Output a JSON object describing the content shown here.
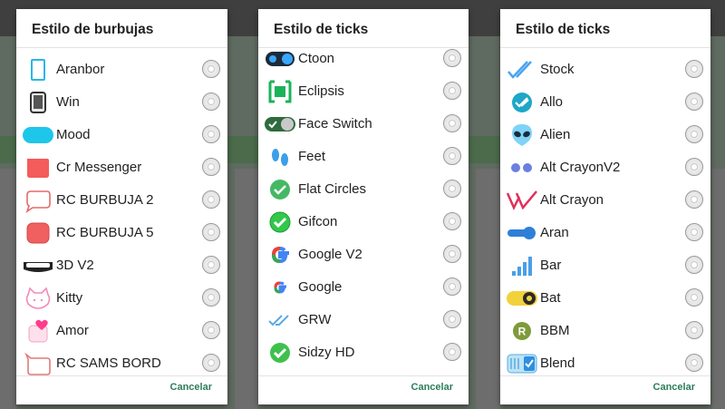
{
  "dialogs": [
    {
      "title": "Estilo de burbujas",
      "cancel": "Cancelar",
      "items": [
        {
          "label": "Aranbor",
          "icon": "bubble-outline-icon"
        },
        {
          "label": "Win",
          "icon": "bubble-window-icon"
        },
        {
          "label": "Mood",
          "icon": "bubble-pill-icon"
        },
        {
          "label": "Cr Messenger",
          "icon": "bubble-messenger-icon"
        },
        {
          "label": "RC BURBUJA 2",
          "icon": "bubble-speech-icon"
        },
        {
          "label": "RC BURBUJA 5",
          "icon": "bubble-rounded-icon"
        },
        {
          "label": "3D V2",
          "icon": "bubble-3d-icon"
        },
        {
          "label": "Kitty",
          "icon": "bubble-kitty-icon"
        },
        {
          "label": "Amor",
          "icon": "bubble-heart-icon"
        },
        {
          "label": "RC SAMS BORD",
          "icon": "bubble-border-icon"
        }
      ]
    },
    {
      "title": "Estilo de ticks",
      "cancel": "Cancelar",
      "items": [
        {
          "label": "Ctoon",
          "icon": "tick-ctoon-icon"
        },
        {
          "label": "Eclipsis",
          "icon": "tick-eclipsis-icon"
        },
        {
          "label": "Face Switch",
          "icon": "tick-switch-icon"
        },
        {
          "label": "Feet",
          "icon": "tick-feet-icon"
        },
        {
          "label": "Flat Circles",
          "icon": "tick-flat-circle-icon"
        },
        {
          "label": "Gifcon",
          "icon": "tick-gifcon-icon"
        },
        {
          "label": "Google V2",
          "icon": "google-v2-icon"
        },
        {
          "label": "Google",
          "icon": "google-icon"
        },
        {
          "label": "GRW",
          "icon": "tick-double-icon"
        },
        {
          "label": "Sidzy HD",
          "icon": "tick-sidzy-icon"
        }
      ]
    },
    {
      "title": "Estilo de ticks",
      "cancel": "Cancelar",
      "items": [
        {
          "label": "Stock",
          "icon": "tick-stock-icon"
        },
        {
          "label": "Allo",
          "icon": "tick-allo-icon"
        },
        {
          "label": "Alien",
          "icon": "alien-icon"
        },
        {
          "label": "Alt CrayonV2",
          "icon": "dots-icon"
        },
        {
          "label": "Alt Crayon",
          "icon": "tick-crayon-icon"
        },
        {
          "label": "Aran",
          "icon": "toggle-icon"
        },
        {
          "label": "Bar",
          "icon": "signal-bars-icon"
        },
        {
          "label": "Bat",
          "icon": "bat-icon"
        },
        {
          "label": "BBM",
          "icon": "bbm-icon"
        },
        {
          "label": "Blend",
          "icon": "tick-blend-icon"
        }
      ]
    }
  ]
}
